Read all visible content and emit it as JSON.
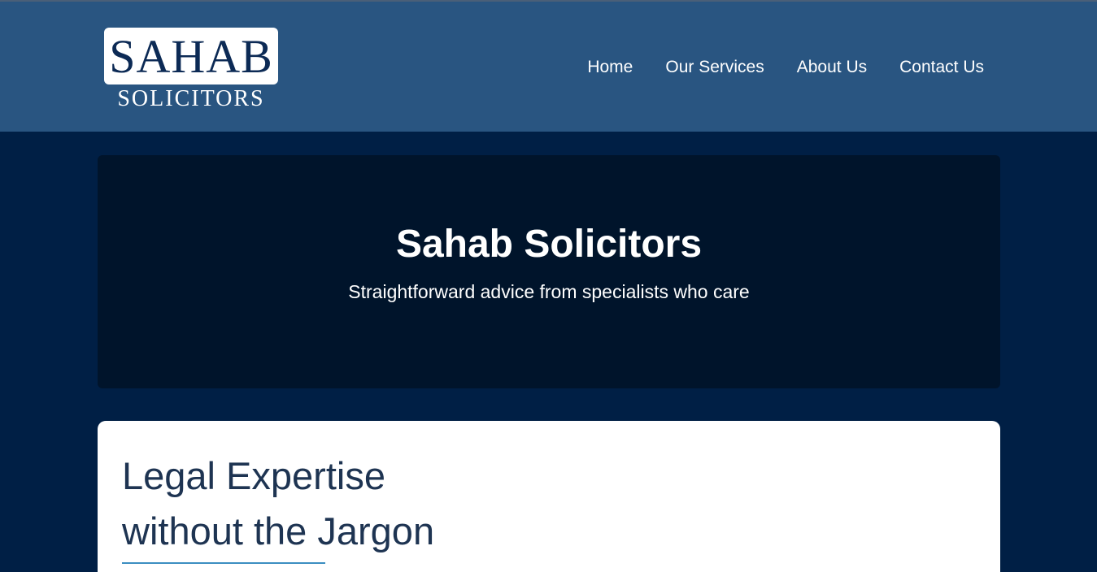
{
  "header": {
    "logo": {
      "main_text": "SAHAB",
      "sub_text": "SOLICITORS"
    },
    "nav": [
      {
        "label": "Home"
      },
      {
        "label": "Our Services"
      },
      {
        "label": "About Us"
      },
      {
        "label": "Contact Us"
      }
    ]
  },
  "hero": {
    "title": "Sahab Solicitors",
    "tagline": "Straightforward advice from specialists who care"
  },
  "intro_card": {
    "heading_line1": "Legal Expertise",
    "heading_line2": "without the Jargon"
  },
  "colors": {
    "header_bg": "#295581",
    "page_bg": "#001f45",
    "hero_bg": "#00142b",
    "heading_text": "#1e3452",
    "accent_underline": "#3b8ec1"
  }
}
